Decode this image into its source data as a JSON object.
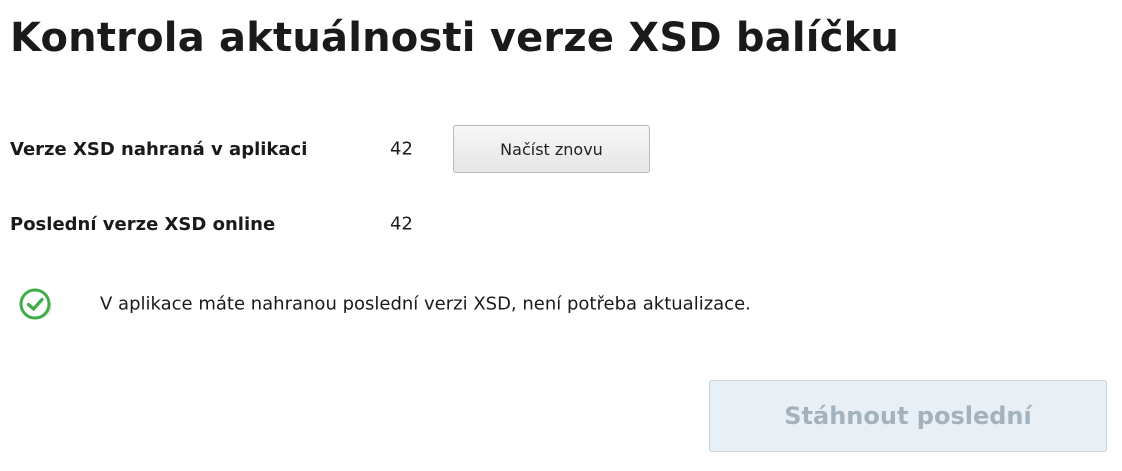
{
  "page": {
    "title": "Kontrola aktuálnosti verze XSD balíčku"
  },
  "loaded_version": {
    "label": "Verze XSD nahraná v aplikaci",
    "value": "42",
    "reload_label": "Načíst znovu"
  },
  "online_version": {
    "label": "Poslední verze XSD online",
    "value": "42"
  },
  "status": {
    "icon": "check-circle-icon",
    "color": "#3fae49",
    "message": "V aplikace máte nahranou poslední verzi XSD, není potřeba aktualizace."
  },
  "download": {
    "label": "Stáhnout poslední",
    "enabled": false
  }
}
